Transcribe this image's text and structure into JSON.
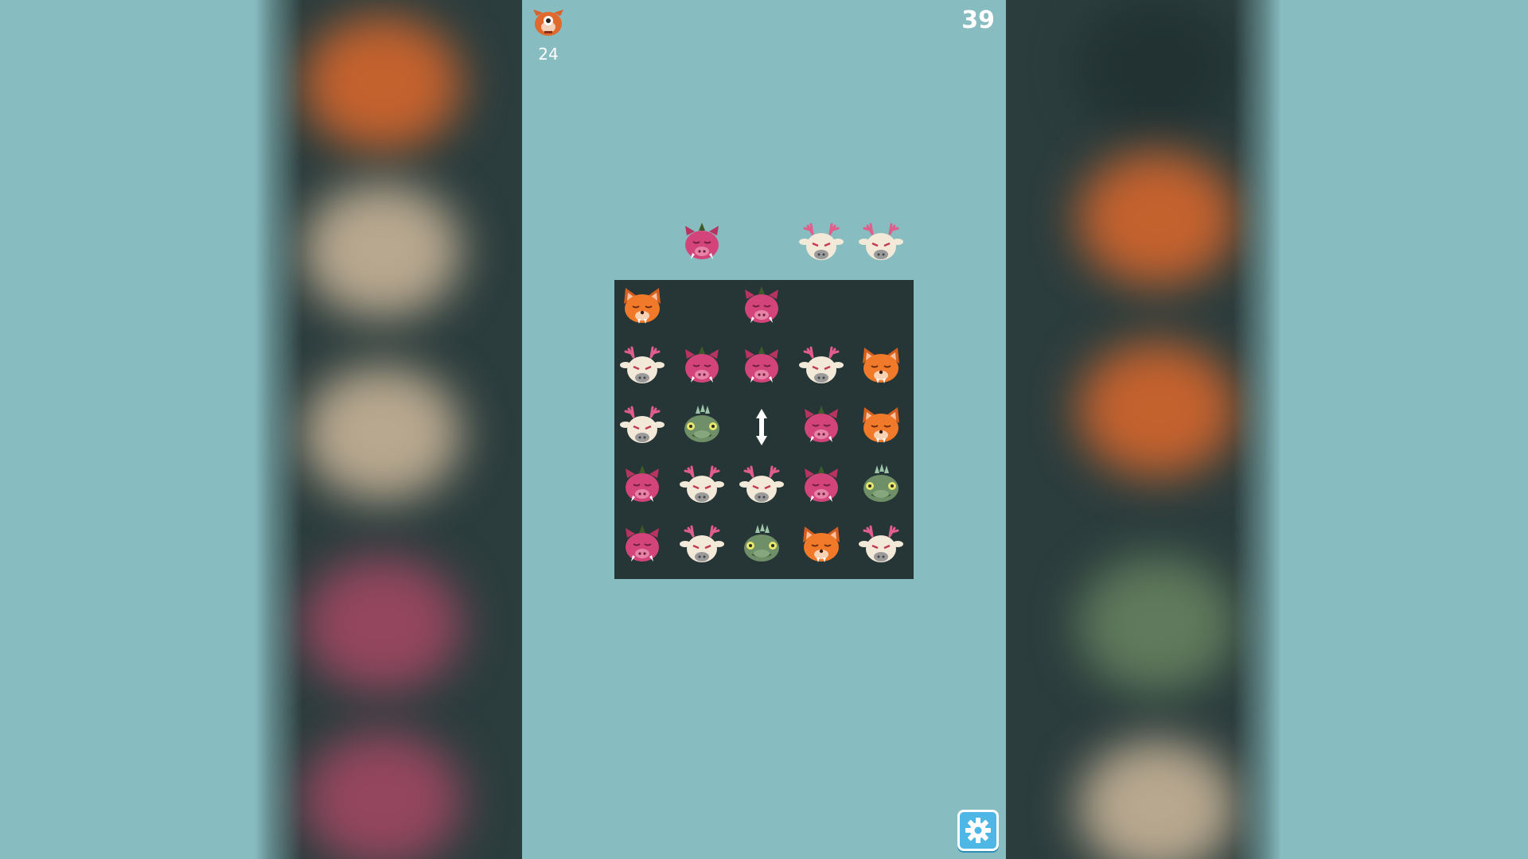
{
  "hud": {
    "target": {
      "icon": "orange-creature-icon",
      "count": "24"
    },
    "moves_left": "39"
  },
  "colors": {
    "background": "#87bcc0",
    "board": "#263535",
    "pig": "#d3457a",
    "deer": "#f3e9d8",
    "fox": "#f07a2a",
    "lizard": "#6f8f68",
    "settings": "#4fb7e6"
  },
  "incoming_pieces": [
    {
      "column": 2,
      "creature": "pig"
    },
    {
      "column": 4,
      "creature": "deer"
    },
    {
      "column": 5,
      "creature": "deer"
    }
  ],
  "board": {
    "rows": 5,
    "cols": 5,
    "cells": [
      [
        "fox",
        null,
        "pig",
        null,
        null
      ],
      [
        "deer",
        "pig",
        "pig",
        "deer",
        "fox"
      ],
      [
        "deer",
        "lizard",
        "swap",
        "pig",
        "fox"
      ],
      [
        "pig",
        "deer",
        "deer",
        "pig",
        "lizard"
      ],
      [
        "pig",
        "deer",
        "lizard",
        "fox",
        "deer"
      ]
    ]
  },
  "settings_icon": "gear-icon"
}
